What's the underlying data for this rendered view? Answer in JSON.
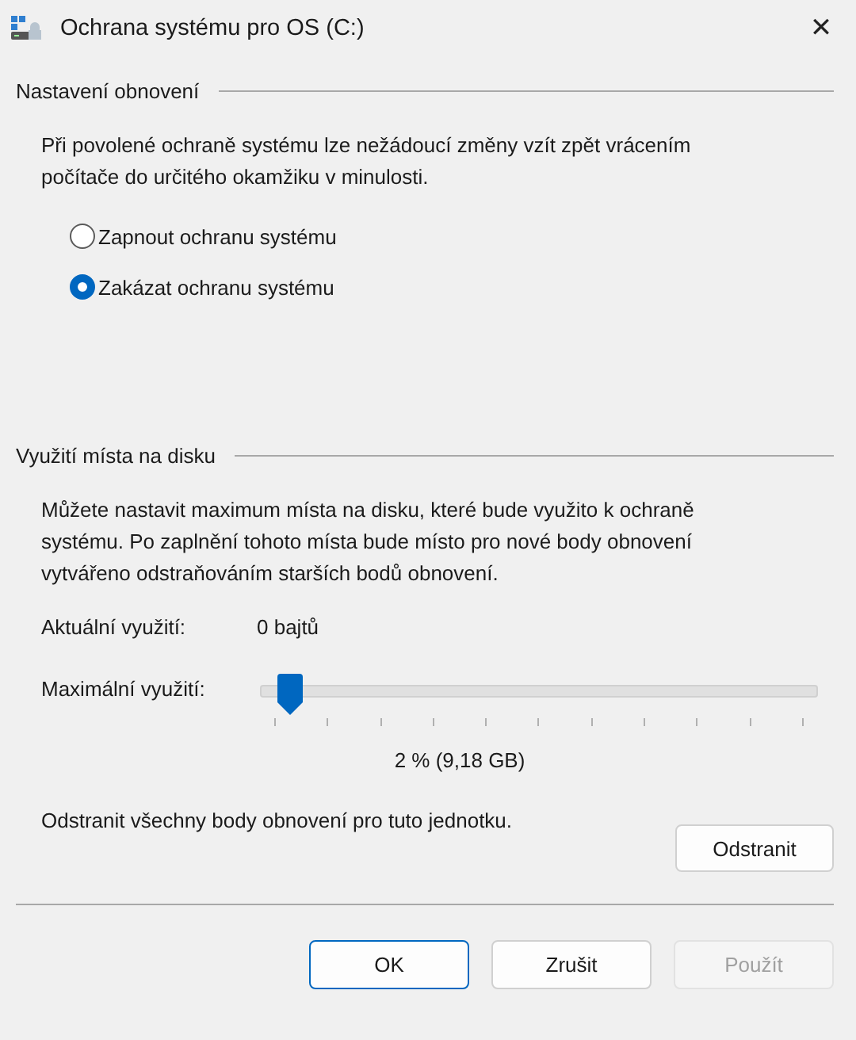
{
  "window": {
    "title": "Ochrana systému pro OS (C:)",
    "close": "✕"
  },
  "restore_settings": {
    "heading": "Nastavení obnovení",
    "description": "Při povolené ochraně systému lze nežádoucí změny vzít zpět vrácením počítače do určitého okamžiku v minulosti.",
    "options": [
      {
        "label": "Zapnout ochranu systému",
        "selected": false
      },
      {
        "label": "Zakázat ochranu systému",
        "selected": true
      }
    ]
  },
  "disk_usage": {
    "heading": "Využití místa na disku",
    "description": "Můžete nastavit maximum místa na disku, které bude využito k ochraně systému. Po zaplnění tohoto místa bude místo pro nové body obnovení vytvářeno odstraňováním starších bodů obnovení.",
    "current_label": "Aktuální využití:",
    "current_value": "0 bajtů",
    "max_label": "Maximální využití:",
    "max_slider": {
      "level": 0.02
    },
    "max_reading": "2 % (9,18 GB)",
    "delete_text": "Odstranit všechny body obnovení pro tuto jednotku.",
    "delete_button": "Odstranit"
  },
  "buttons": [
    {
      "label": "OK",
      "default": true,
      "disabled": false
    },
    {
      "label": "Zrušit",
      "default": false,
      "disabled": false
    },
    {
      "label": "Použít",
      "default": false,
      "disabled": true
    }
  ]
}
